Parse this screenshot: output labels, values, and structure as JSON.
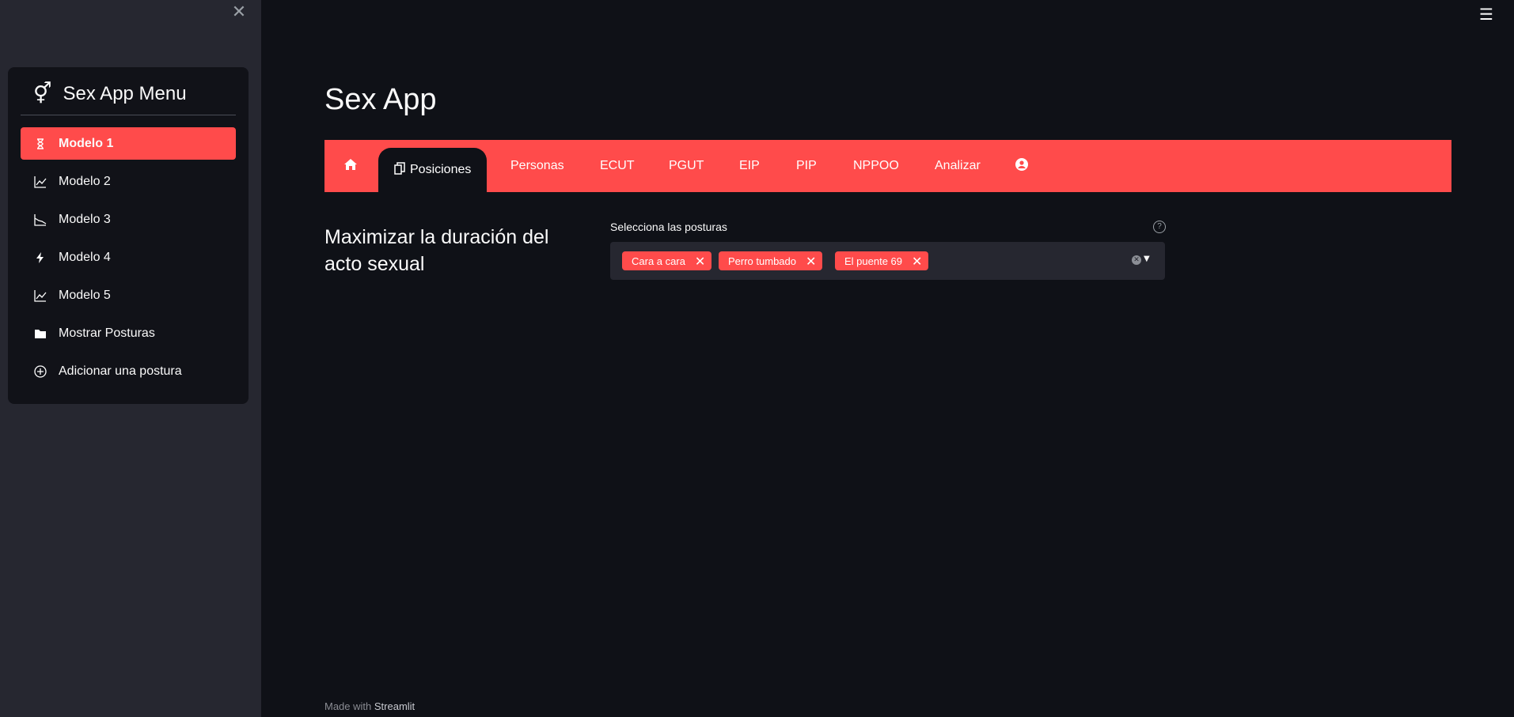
{
  "sidebar": {
    "close_icon": "close-icon",
    "menu": {
      "title": "Sex App Menu",
      "title_icon": "gender-icon",
      "items": [
        {
          "label": "Modelo 1",
          "icon": "hourglass-icon",
          "active": true
        },
        {
          "label": "Modelo 2",
          "icon": "chart-line-icon",
          "active": false
        },
        {
          "label": "Modelo 3",
          "icon": "chart-area-icon",
          "active": false
        },
        {
          "label": "Modelo 4",
          "icon": "lightning-icon",
          "active": false
        },
        {
          "label": "Modelo 5",
          "icon": "chart-line-icon",
          "active": false
        },
        {
          "label": "Mostrar Posturas",
          "icon": "folder-icon",
          "active": false
        },
        {
          "label": "Adicionar una postura",
          "icon": "plus-circle-icon",
          "active": false
        }
      ]
    }
  },
  "header": {
    "menu_icon": "hamburger-icon"
  },
  "main": {
    "title": "Sex App",
    "navbar": {
      "items": [
        {
          "label": "",
          "icon": "home-icon"
        },
        {
          "label": "Posiciones",
          "icon": "copy-icon",
          "active": true
        },
        {
          "label": "Personas"
        },
        {
          "label": "ECUT"
        },
        {
          "label": "PGUT"
        },
        {
          "label": "EIP"
        },
        {
          "label": "PIP"
        },
        {
          "label": "NPPOO"
        },
        {
          "label": "Analizar"
        },
        {
          "label": "",
          "icon": "user-circle-icon"
        }
      ]
    },
    "subheading": "Maximizar la duración del acto sexual",
    "multiselect": {
      "label": "Selecciona las posturas",
      "selected": [
        "Cara a cara",
        "Perro tumbado",
        "El puente 69"
      ]
    }
  },
  "footer": {
    "prefix": "Made with",
    "brand": "Streamlit"
  },
  "colors": {
    "accent": "#ff4b4b",
    "background": "#0f1117",
    "sidebar": "#262730"
  }
}
